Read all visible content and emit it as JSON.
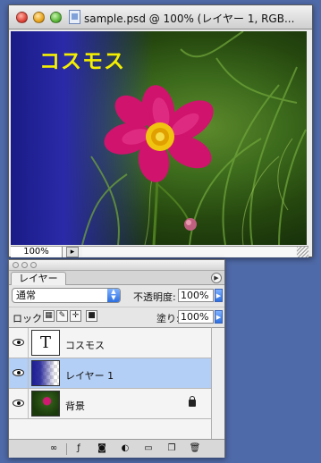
{
  "document": {
    "title": "sample.psd @ 100% (レイヤー 1, RGB...",
    "canvas_text": "コスモス",
    "zoom": "100%",
    "status_icon": "arrow-icon"
  },
  "layers_panel": {
    "tab_label": "レイヤー",
    "blend_mode": "通常",
    "opacity_label": "不透明度:",
    "opacity_value": "100%",
    "lock_label": "ロック:",
    "fill_label": "塗り:",
    "fill_value": "100%",
    "lock_buttons": [
      "lock-transparent-icon",
      "lock-paint-icon",
      "lock-move-icon",
      "lock-all-icon"
    ],
    "layers": [
      {
        "name": "コスモス",
        "type": "text",
        "thumb_text": "T",
        "selected": false,
        "locked": false
      },
      {
        "name": "レイヤー 1",
        "type": "gradient",
        "selected": true,
        "locked": false
      },
      {
        "name": "背景",
        "type": "photo",
        "selected": false,
        "locked": true
      }
    ],
    "footer_buttons": [
      "link-icon",
      "layer-style-icon",
      "mask-icon",
      "adjustment-icon",
      "group-folder-icon",
      "new-layer-icon",
      "trash-icon"
    ]
  },
  "colors": {
    "desktop": "#4f6aa8",
    "canvas_text": "#f4ef00",
    "selection": "#b4cff5",
    "accent_blue": "#2c6fe0"
  }
}
